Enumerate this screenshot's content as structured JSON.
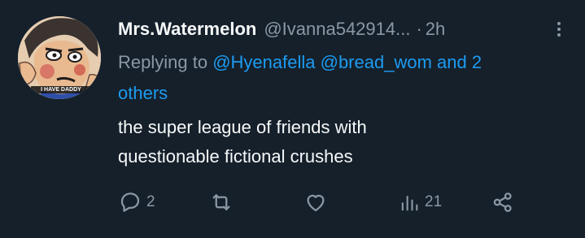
{
  "tweet": {
    "author": {
      "display_name": "Mrs.Watermelon",
      "handle": "@Ivanna542914...",
      "separator": "·",
      "time": "2h",
      "avatar_caption": "I HAVE DADDY"
    },
    "reply": {
      "prefix": "Replying to ",
      "mention_1": "@Hyenafella",
      "mention_2": "@bread_wom",
      "suffix_line1": " and 2",
      "suffix_line2": "others"
    },
    "text_lines": [
      "the super league of friends with",
      "questionable fictional crushes"
    ],
    "actions": {
      "reply_count": "2",
      "retweet_count": "",
      "like_count": "",
      "views_count": "21"
    },
    "icons": {
      "more": "more-vertical-icon",
      "reply": "reply-bubble-icon",
      "retweet": "retweet-icon",
      "like": "heart-icon",
      "views": "analytics-bars-icon",
      "share": "share-nodes-icon"
    },
    "colors": {
      "background": "#15202b",
      "primary_text": "#f7f9f9",
      "secondary_text": "#8b98a5",
      "link": "#1d9bf0"
    }
  }
}
